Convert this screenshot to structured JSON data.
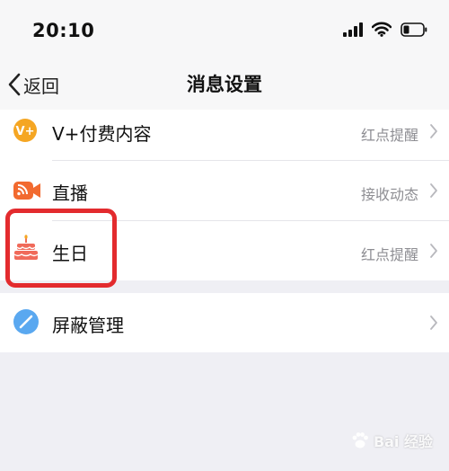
{
  "status_bar": {
    "time": "20:10"
  },
  "nav": {
    "back_label": "返回",
    "title": "消息设置"
  },
  "settings": {
    "items": [
      {
        "label": "V+付费内容",
        "value": "红点提醒",
        "icon": "vplus-icon"
      },
      {
        "label": "直播",
        "value": "接收动态",
        "icon": "live-camera-icon"
      },
      {
        "label": "生日",
        "value": "红点提醒",
        "icon": "birthday-cake-icon"
      }
    ],
    "block": {
      "label": "屏蔽管理",
      "icon": "block-icon"
    }
  },
  "watermark": {
    "text": "Bai 经验"
  },
  "colors": {
    "vplus": "#f5a623",
    "live": "#f26a2f",
    "cake": "#f06a5a",
    "block": "#5aa8f0",
    "highlight": "#e32b2e"
  }
}
